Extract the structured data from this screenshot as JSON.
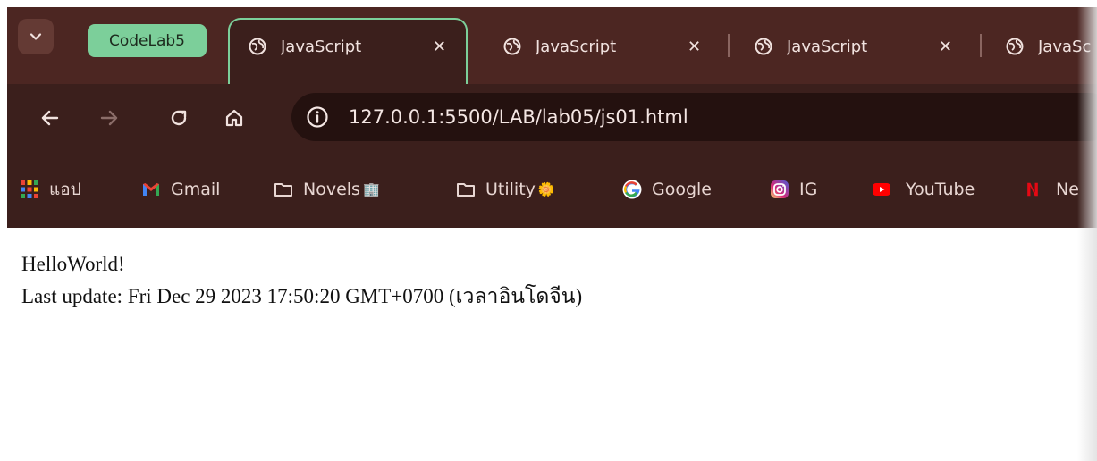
{
  "tab_group": {
    "label": "CodeLab5",
    "color": "#7ccf9a"
  },
  "tabs": [
    {
      "title": "JavaScript",
      "active": true
    },
    {
      "title": "JavaScript",
      "active": false
    },
    {
      "title": "JavaScript",
      "active": false
    },
    {
      "title": "JavaScript",
      "active": false
    }
  ],
  "tab_close_glyph": "✕",
  "address_bar": {
    "url": "127.0.0.1:5500/LAB/lab05/js01.html"
  },
  "bookmarks": [
    {
      "label": "แอป",
      "icon": "apps-grid-icon"
    },
    {
      "label": "Gmail",
      "icon": "gmail-icon"
    },
    {
      "label": "Novels",
      "icon": "folder-icon",
      "emoji": "🏢"
    },
    {
      "label": "Utility",
      "icon": "folder-icon",
      "emoji": "🌼"
    },
    {
      "label": "Google",
      "icon": "google-icon"
    },
    {
      "label": "IG",
      "icon": "instagram-icon"
    },
    {
      "label": "YouTube",
      "icon": "youtube-icon"
    },
    {
      "label": "Ne",
      "icon": "netflix-icon"
    }
  ],
  "page": {
    "line1": "HelloWorld!",
    "line2": "Last update: Fri Dec 29 2023 17:50:20 GMT+0700 (เวลาอินโดจีน)"
  },
  "colors": {
    "tabstrip": "#4c2622",
    "toolbar": "#3b1f1c",
    "omnibox": "#24110f",
    "accent": "#7ccf9a"
  }
}
